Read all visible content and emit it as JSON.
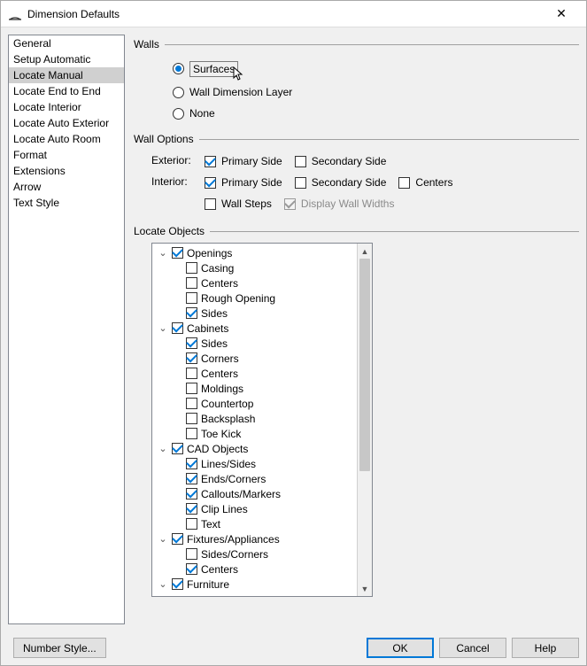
{
  "window": {
    "title": "Dimension Defaults"
  },
  "sidebar": {
    "items": [
      "General",
      "Setup Automatic",
      "Locate Manual",
      "Locate End to End",
      "Locate Interior",
      "Locate Auto Exterior",
      "Locate Auto Room",
      "Format",
      "Extensions",
      "Arrow",
      "Text Style"
    ],
    "selected_index": 2
  },
  "walls": {
    "header": "Walls",
    "options": {
      "surfaces": "Surfaces",
      "wall_dim_layer": "Wall Dimension Layer",
      "none": "None"
    },
    "selected": "surfaces"
  },
  "wall_options": {
    "header": "Wall Options",
    "labels": {
      "exterior": "Exterior:",
      "interior": "Interior:"
    },
    "exterior": {
      "primary": {
        "label": "Primary Side",
        "checked": true
      },
      "secondary": {
        "label": "Secondary Side",
        "checked": false
      }
    },
    "interior": {
      "primary": {
        "label": "Primary Side",
        "checked": true
      },
      "secondary": {
        "label": "Secondary Side",
        "checked": false
      },
      "centers": {
        "label": "Centers",
        "checked": false
      }
    },
    "wall_steps": {
      "label": "Wall Steps",
      "checked": false
    },
    "display_widths": {
      "label": "Display Wall Widths",
      "checked": true,
      "disabled": true
    }
  },
  "locate": {
    "header": "Locate Objects",
    "tree": [
      {
        "depth": 0,
        "exp": true,
        "check": true,
        "label": "Openings"
      },
      {
        "depth": 1,
        "check": false,
        "label": "Casing"
      },
      {
        "depth": 1,
        "check": false,
        "label": "Centers"
      },
      {
        "depth": 1,
        "check": false,
        "label": "Rough Opening"
      },
      {
        "depth": 1,
        "check": true,
        "label": "Sides"
      },
      {
        "depth": 0,
        "exp": true,
        "check": true,
        "label": "Cabinets"
      },
      {
        "depth": 1,
        "check": true,
        "label": "Sides"
      },
      {
        "depth": 1,
        "check": true,
        "label": "Corners"
      },
      {
        "depth": 1,
        "check": false,
        "label": "Centers"
      },
      {
        "depth": 1,
        "check": false,
        "label": "Moldings"
      },
      {
        "depth": 1,
        "check": false,
        "label": "Countertop"
      },
      {
        "depth": 1,
        "check": false,
        "label": "Backsplash"
      },
      {
        "depth": 1,
        "check": false,
        "label": "Toe Kick"
      },
      {
        "depth": 0,
        "exp": true,
        "check": true,
        "label": "CAD Objects"
      },
      {
        "depth": 1,
        "check": true,
        "label": "Lines/Sides"
      },
      {
        "depth": 1,
        "check": true,
        "label": "Ends/Corners"
      },
      {
        "depth": 1,
        "check": true,
        "label": "Callouts/Markers"
      },
      {
        "depth": 1,
        "check": true,
        "label": "Clip Lines"
      },
      {
        "depth": 1,
        "check": false,
        "label": "Text"
      },
      {
        "depth": 0,
        "exp": true,
        "check": true,
        "label": "Fixtures/Appliances"
      },
      {
        "depth": 1,
        "check": false,
        "label": "Sides/Corners"
      },
      {
        "depth": 1,
        "check": true,
        "label": "Centers"
      },
      {
        "depth": 0,
        "exp": true,
        "check": true,
        "label": "Furniture"
      }
    ]
  },
  "footer": {
    "number_style": "Number Style...",
    "ok": "OK",
    "cancel": "Cancel",
    "help": "Help"
  }
}
